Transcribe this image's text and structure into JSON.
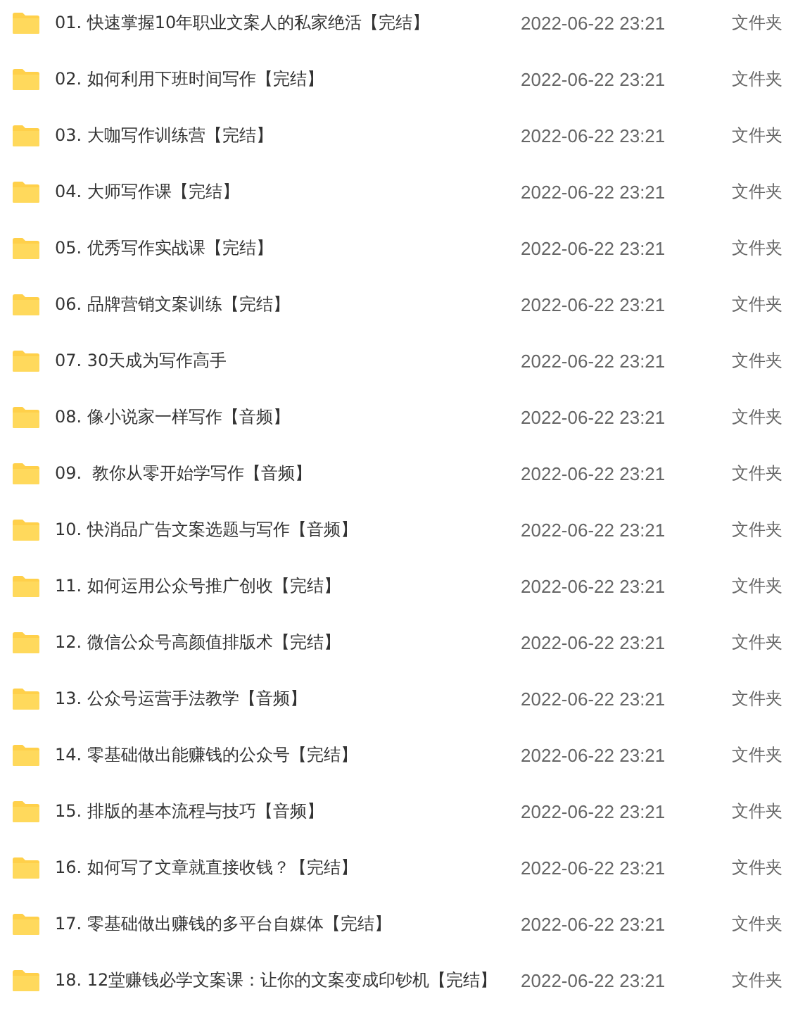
{
  "files": [
    {
      "name": "01. 快速掌握10年职业文案人的私家绝活【完结】",
      "modified": "2022-06-22 23:21",
      "type": "文件夹"
    },
    {
      "name": "02. 如何利用下班时间写作【完结】",
      "modified": "2022-06-22 23:21",
      "type": "文件夹"
    },
    {
      "name": "03. 大咖写作训练营【完结】",
      "modified": "2022-06-22 23:21",
      "type": "文件夹"
    },
    {
      "name": "04. 大师写作课【完结】",
      "modified": "2022-06-22 23:21",
      "type": "文件夹"
    },
    {
      "name": "05. 优秀写作实战课【完结】",
      "modified": "2022-06-22 23:21",
      "type": "文件夹"
    },
    {
      "name": "06. 品牌营销文案训练【完结】",
      "modified": "2022-06-22 23:21",
      "type": "文件夹"
    },
    {
      "name": "07. 30天成为写作高手",
      "modified": "2022-06-22 23:21",
      "type": "文件夹"
    },
    {
      "name": "08. 像小说家一样写作【音频】",
      "modified": "2022-06-22 23:21",
      "type": "文件夹"
    },
    {
      "name": "09.  教你从零开始学写作【音频】",
      "modified": "2022-06-22 23:21",
      "type": "文件夹"
    },
    {
      "name": "10. 快消品广告文案选题与写作【音频】",
      "modified": "2022-06-22 23:21",
      "type": "文件夹"
    },
    {
      "name": "11. 如何运用公众号推广创收【完结】",
      "modified": "2022-06-22 23:21",
      "type": "文件夹"
    },
    {
      "name": "12. 微信公众号高颜值排版术【完结】",
      "modified": "2022-06-22 23:21",
      "type": "文件夹"
    },
    {
      "name": "13. 公众号运营手法教学【音频】",
      "modified": "2022-06-22 23:21",
      "type": "文件夹"
    },
    {
      "name": "14. 零基础做出能赚钱的公众号【完结】",
      "modified": "2022-06-22 23:21",
      "type": "文件夹"
    },
    {
      "name": "15. 排版的基本流程与技巧【音频】",
      "modified": "2022-06-22 23:21",
      "type": "文件夹"
    },
    {
      "name": "16. 如何写了文章就直接收钱？【完结】",
      "modified": "2022-06-22 23:21",
      "type": "文件夹"
    },
    {
      "name": "17. 零基础做出赚钱的多平台自媒体【完结】",
      "modified": "2022-06-22 23:21",
      "type": "文件夹"
    },
    {
      "name": "18. 12堂赚钱必学文案课：让你的文案变成印钞机【完结】",
      "modified": "2022-06-22 23:21",
      "type": "文件夹"
    }
  ]
}
